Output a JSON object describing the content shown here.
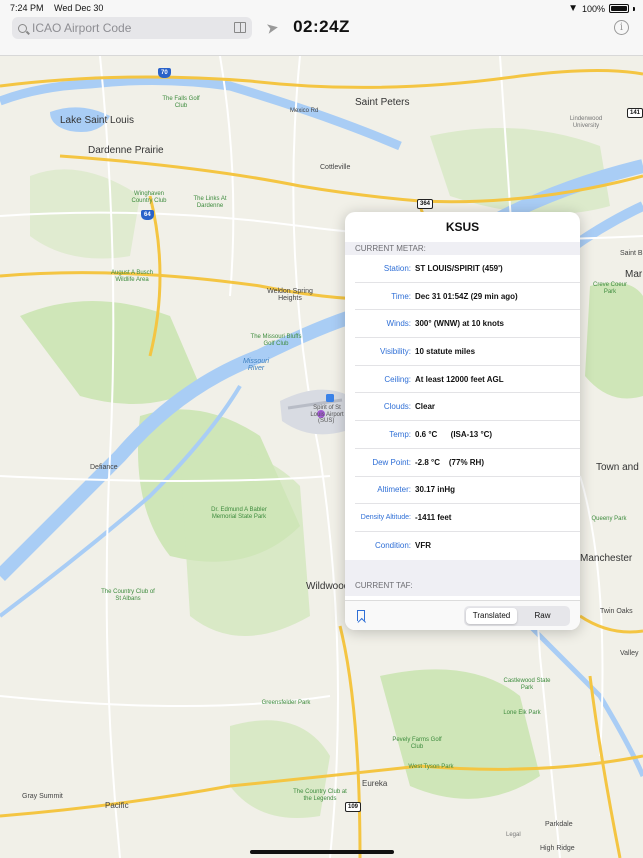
{
  "status_bar": {
    "time": "7:24 PM",
    "date": "Wed Dec 30",
    "battery": "100%"
  },
  "toolbar": {
    "search_placeholder": "ICAO Airport Code",
    "clock": "02:24Z"
  },
  "map": {
    "labels": {
      "saint_peters": "Saint Peters",
      "lake_saint_louis": "Lake Saint Louis",
      "dardenne_prairie": "Dardenne Prairie",
      "cottleville": "Cottleville",
      "weldon_spring": "Weldon Spring Heights",
      "defiance": "Defiance",
      "wildwood": "Wildwood",
      "pacific": "Pacific",
      "eureka": "Eureka",
      "gray_summit": "Gray Summit",
      "town_and": "Town and",
      "manchester": "Manchester",
      "twin_oaks": "Twin Oaks",
      "valley": "Valley",
      "parkdale": "Parkdale",
      "high_ridge": "High Ridge",
      "mar": "Mar",
      "saint_b": "Saint B",
      "mexico_rd": "Mexico Rd",
      "missouri_river": "Missouri River",
      "falls_golf": "The Falls Golf Club",
      "lindenwood": "Lindenwood University",
      "winghaven": "Winghaven Country Club",
      "links_dardenne": "The Links At Dardenne",
      "busch_wildlife": "August A Busch Wildlife Area",
      "missouri_bluffs": "The Missouri Bluffs Golf Club",
      "babler": "Dr. Edmund A Babler Memorial State Park",
      "country_club_st_albans": "The Country Club of St Albans",
      "greensfelder": "Greensfelder Park",
      "pevely_farms": "Pevely Farms Golf Club",
      "country_club_legends": "The Country Club at the Legends",
      "castlewood": "Castlewood State Park",
      "lone_elk": "Lone Elk Park",
      "west_tyson": "West Tyson Park",
      "queeny": "Queeny Park",
      "creve_coeur": "Creve Coeur Park",
      "airport": "Spirit of St Louis Airport",
      "airport_code": "(SUS)",
      "legal": "Legal"
    },
    "shields": {
      "i70": "70",
      "i64": "64",
      "us364": "364",
      "us109": "109",
      "r141": "141"
    }
  },
  "card": {
    "title": "KSUS",
    "metar_header": "CURRENT METAR:",
    "rows": [
      {
        "label": "Station:",
        "value": "ST LOUIS/SPIRIT (459')"
      },
      {
        "label": "Time:",
        "value": "Dec 31 01:54Z (29 min ago)"
      },
      {
        "label": "Winds:",
        "value": "300° (WNW) at 10 knots"
      },
      {
        "label": "Visibility:",
        "value": "10 statute miles"
      },
      {
        "label": "Ceiling:",
        "value": "At least 12000 feet AGL"
      },
      {
        "label": "Clouds:",
        "value": "Clear"
      },
      {
        "label": "Temp:",
        "value": "0.6 °C      (ISA-13 °C)"
      },
      {
        "label": "Dew Point:",
        "value": "-2.8 °C    (77% RH)"
      },
      {
        "label": "Altimeter:",
        "value": "30.17 inHg"
      },
      {
        "label": "Density Altitude:",
        "value": "-1411 feet"
      },
      {
        "label": "Condition:",
        "value": "VFR"
      }
    ],
    "taf_header": "CURRENT TAF:",
    "segments": {
      "translated": "Translated",
      "raw": "Raw",
      "selected": "Translated"
    }
  },
  "colors": {
    "accent": "#2f6fd6",
    "water": "#a9cdf5",
    "park": "#c8e4b0",
    "road_major": "#f7c948"
  }
}
